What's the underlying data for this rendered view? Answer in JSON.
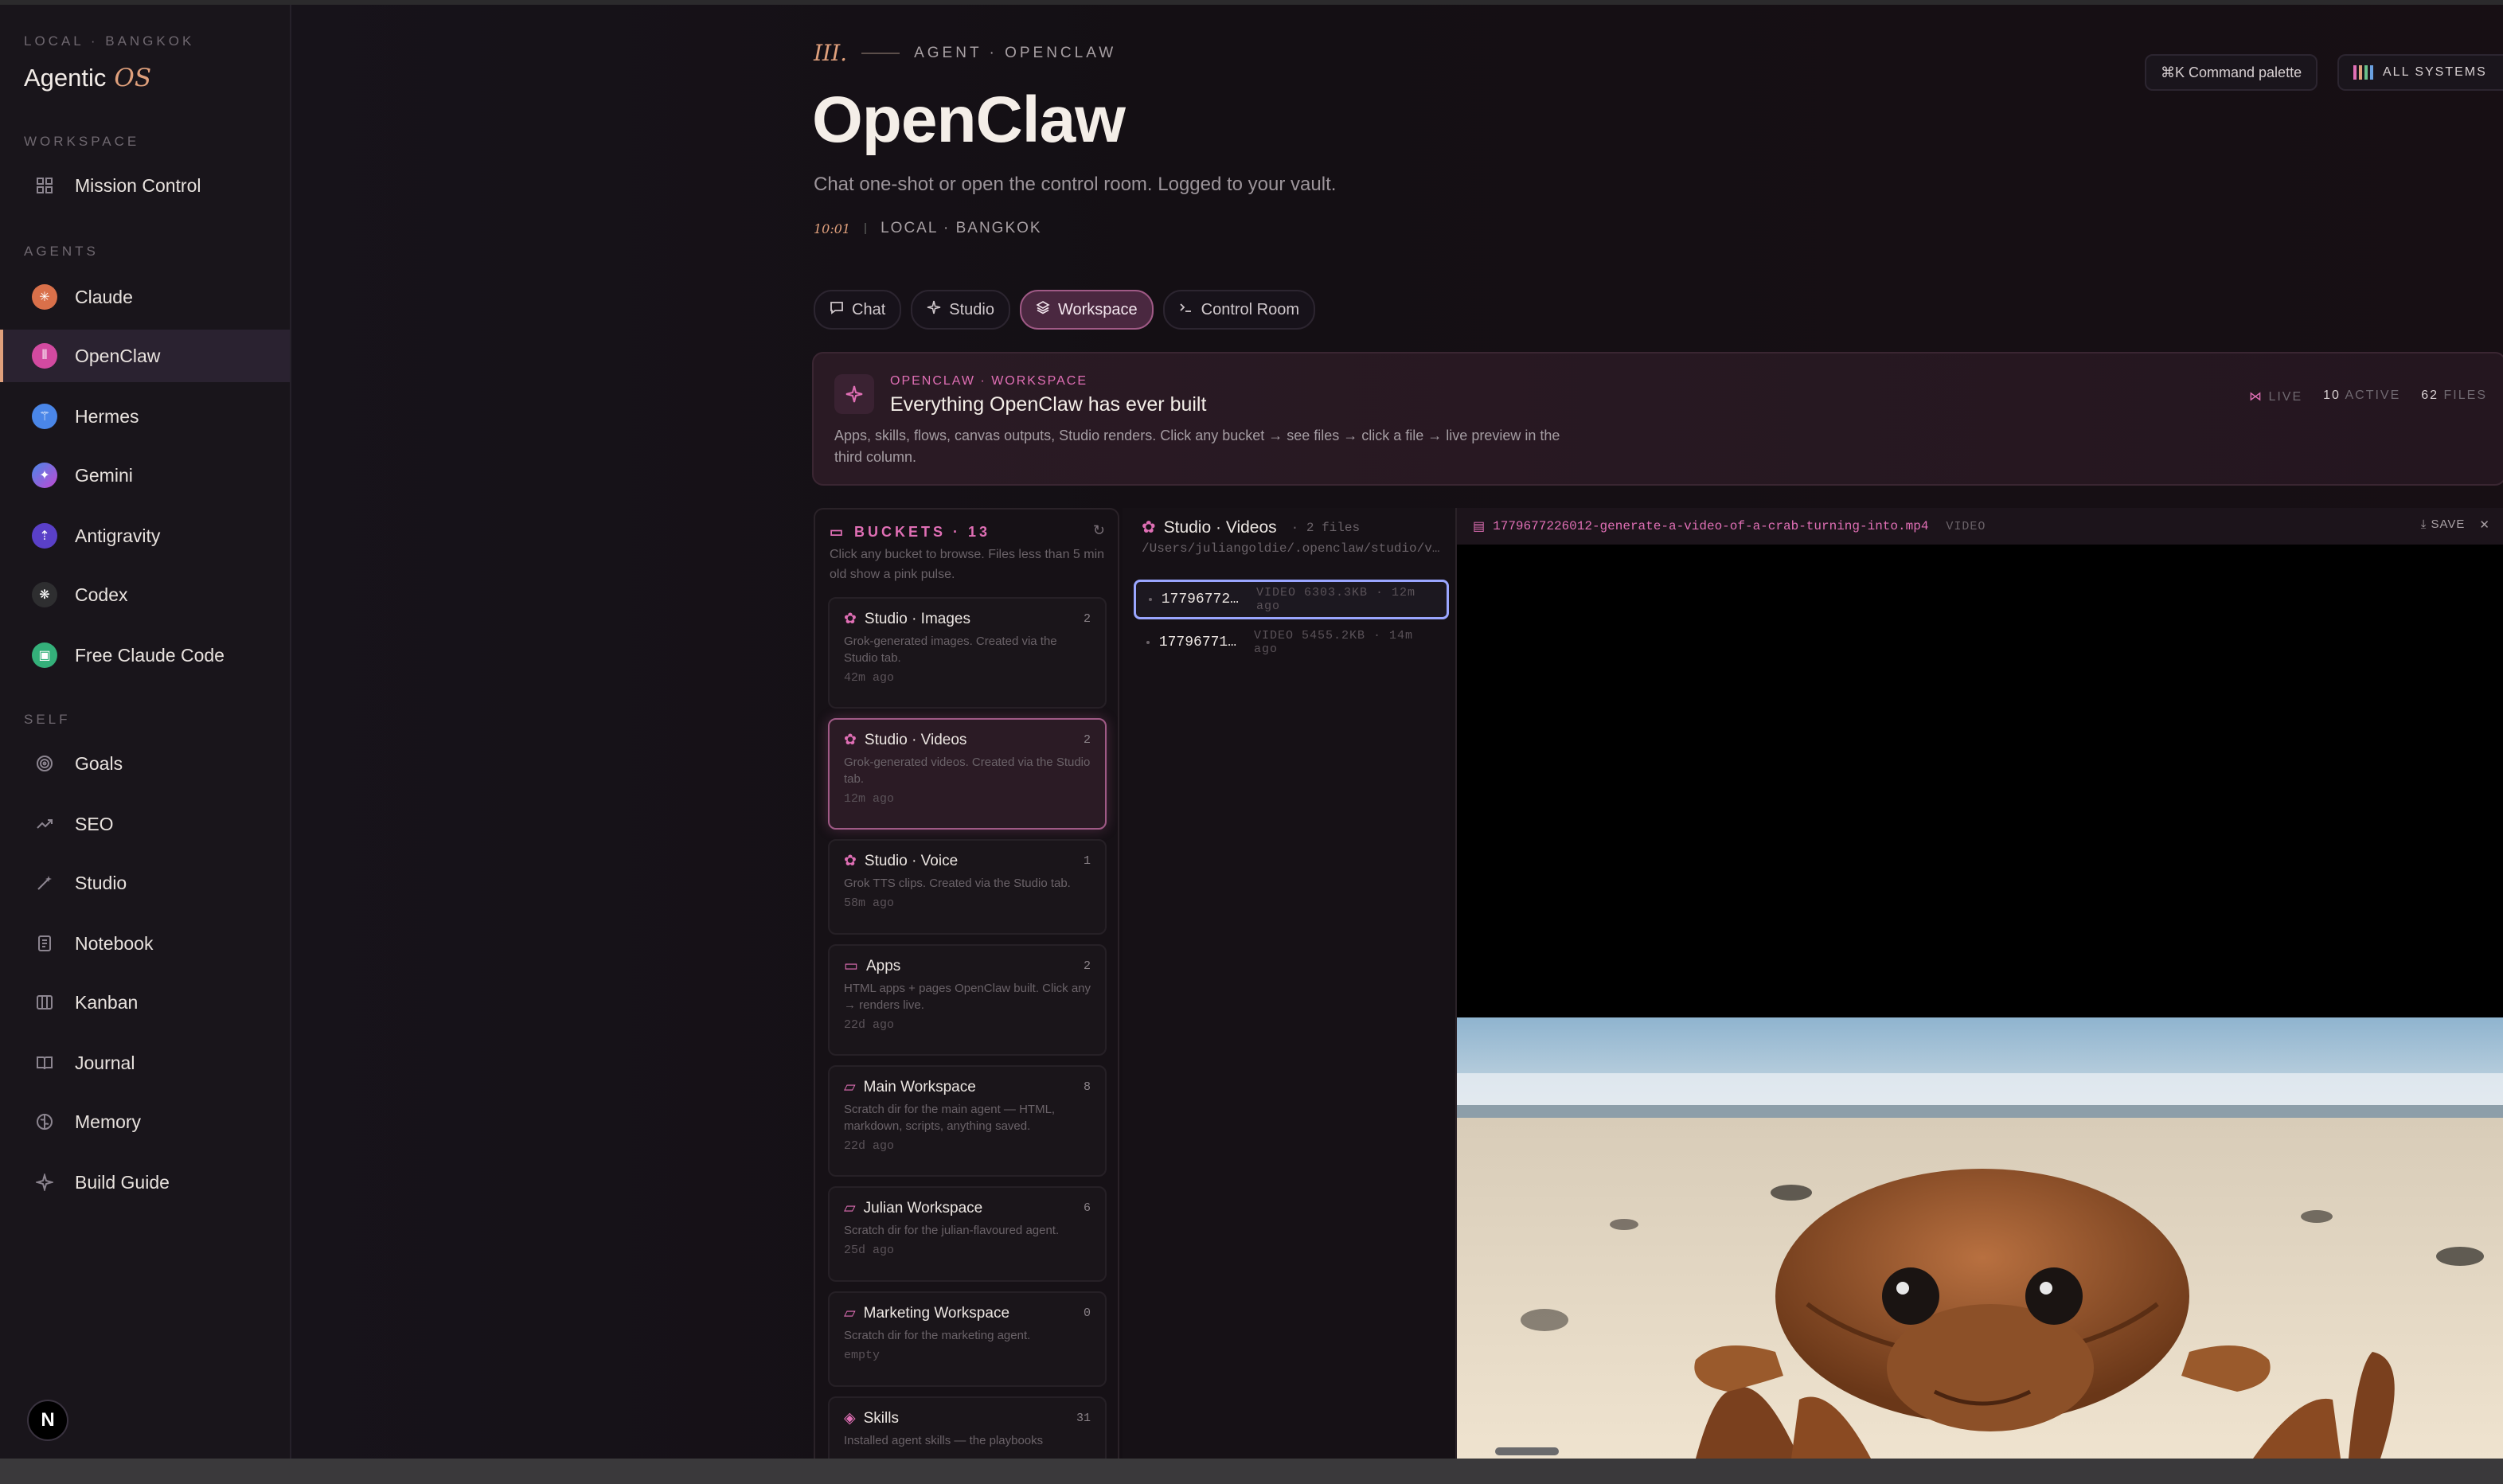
{
  "sidebar": {
    "eyebrow": "LOCAL · BANGKOK",
    "brand": "Agentic",
    "brand_os": "OS",
    "workspace_label": "WORKSPACE",
    "workspace_items": [
      {
        "label": "Mission Control",
        "icon": "grid-icon"
      }
    ],
    "agents_label": "AGENTS",
    "agents": [
      {
        "label": "Claude",
        "color": "#d9704a"
      },
      {
        "label": "OpenClaw",
        "color": "#d24aa0"
      },
      {
        "label": "Hermes",
        "color": "#4a86e8"
      },
      {
        "label": "Gemini",
        "color": "#7a5ae0"
      },
      {
        "label": "Antigravity",
        "color": "#5a40c8"
      },
      {
        "label": "Codex",
        "color": "#3a3a3a"
      },
      {
        "label": "Free Claude Code",
        "color": "#34b07a"
      }
    ],
    "self_label": "SELF",
    "self_items": [
      {
        "label": "Goals",
        "icon": "target-icon"
      },
      {
        "label": "SEO",
        "icon": "trend-icon"
      },
      {
        "label": "Studio",
        "icon": "wand-icon"
      },
      {
        "label": "Notebook",
        "icon": "notebook-icon"
      },
      {
        "label": "Kanban",
        "icon": "kanban-icon"
      },
      {
        "label": "Journal",
        "icon": "book-icon"
      },
      {
        "label": "Memory",
        "icon": "brain-icon"
      },
      {
        "label": "Build Guide",
        "icon": "sparkle-icon"
      }
    ],
    "user_initial": "N"
  },
  "header": {
    "roman": "III.",
    "eyebrow": "AGENT · OPENCLAW",
    "title": "OpenClaw",
    "subtitle": "Chat one-shot or open the control room. Logged to your vault.",
    "time": "10:01",
    "location": "LOCAL · BANGKOK",
    "command_palette": "⌘K  Command palette",
    "systems": "ALL SYSTEMS"
  },
  "tabs": [
    {
      "label": "Chat",
      "icon": "chat-icon"
    },
    {
      "label": "Studio",
      "icon": "sparkle-icon"
    },
    {
      "label": "Workspace",
      "icon": "layers-icon"
    },
    {
      "label": "Control Room",
      "icon": "terminal-icon"
    }
  ],
  "banner": {
    "eyebrow": "OPENCLAW · WORKSPACE",
    "title": "Everything OpenClaw has ever built",
    "desc": "Apps, skills, flows, canvas outputs, Studio renders. Click any bucket → see files → click a file → live preview in the third column.",
    "live": "LIVE",
    "active_num": "10",
    "active_lbl": "ACTIVE",
    "files_num": "62",
    "files_lbl": "FILES"
  },
  "buckets": {
    "heading": "BUCKETS · 13",
    "hint": "Click any bucket to browse. Files less than 5 min old show a pink pulse.",
    "items": [
      {
        "name": "Studio · Images",
        "count": "2",
        "desc": "Grok-generated images. Created via the Studio tab.",
        "time": "42m ago"
      },
      {
        "name": "Studio · Videos",
        "count": "2",
        "desc": "Grok-generated videos. Created via the Studio tab.",
        "time": "12m ago"
      },
      {
        "name": "Studio · Voice",
        "count": "1",
        "desc": "Grok TTS clips. Created via the Studio tab.",
        "time": "58m ago"
      },
      {
        "name": "Apps",
        "count": "2",
        "desc": "HTML apps + pages OpenClaw built. Click any → renders live.",
        "time": "22d ago"
      },
      {
        "name": "Main Workspace",
        "count": "8",
        "desc": "Scratch dir for the main agent — HTML, markdown, scripts, anything saved.",
        "time": "22d ago"
      },
      {
        "name": "Julian Workspace",
        "count": "6",
        "desc": "Scratch dir for the julian-flavoured agent.",
        "time": "25d ago"
      },
      {
        "name": "Marketing Workspace",
        "count": "0",
        "desc": "Scratch dir for the marketing agent.",
        "time": "empty"
      },
      {
        "name": "Skills",
        "count": "31",
        "desc": "Installed agent skills — the playbooks",
        "time": ""
      }
    ]
  },
  "files": {
    "title": "Studio · Videos",
    "count": "· 2 files",
    "path": "/Users/juliangoldie/.openclaw/studio/v…",
    "items": [
      {
        "name": "17796772…",
        "meta": "VIDEO  6303.3KB · 12m ago"
      },
      {
        "name": "17796771…",
        "meta": "VIDEO  5455.2KB · 14m ago"
      }
    ]
  },
  "preview": {
    "filename": "1779677226012-generate-a-video-of-a-crab-turning-into.mp4",
    "tag": "VIDEO",
    "save": "SAVE",
    "close": "✕"
  }
}
